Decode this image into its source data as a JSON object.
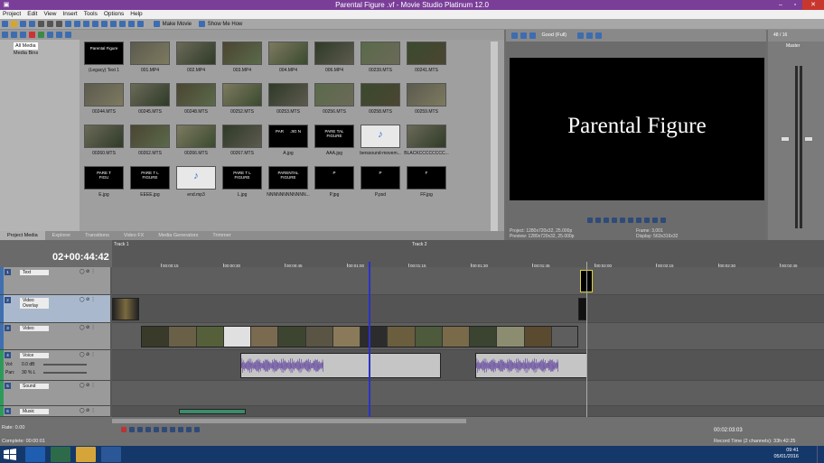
{
  "window": {
    "title": "Parental Figure .vf - Movie Studio Platinum 12.0"
  },
  "menu": [
    "Project",
    "Edit",
    "View",
    "Insert",
    "Tools",
    "Options",
    "Help"
  ],
  "toolbar": {
    "make_movie": "Make Movie",
    "show_me_how": "Show Me How"
  },
  "tree": {
    "items": [
      "All Media",
      "Media Bins"
    ]
  },
  "media": [
    {
      "label": "(Legacy) Text 1",
      "kind": "title",
      "text": "Parental Figure"
    },
    {
      "label": "001.MP4",
      "kind": "video"
    },
    {
      "label": "002.MP4",
      "kind": "video"
    },
    {
      "label": "003.MP4",
      "kind": "video"
    },
    {
      "label": "004.MP4",
      "kind": "video"
    },
    {
      "label": "006.MP4",
      "kind": "video"
    },
    {
      "label": "00239.MTS",
      "kind": "video"
    },
    {
      "label": "00241.MTS",
      "kind": "video"
    },
    {
      "label": "00244.MTS",
      "kind": "video"
    },
    {
      "label": "00245.MTS",
      "kind": "video"
    },
    {
      "label": "00248.MTS",
      "kind": "video"
    },
    {
      "label": "00252.MTS",
      "kind": "video"
    },
    {
      "label": "00253.MTS",
      "kind": "video"
    },
    {
      "label": "00256.MTS",
      "kind": "video"
    },
    {
      "label": "00258.MTS",
      "kind": "video"
    },
    {
      "label": "00259.MTS",
      "kind": "video"
    },
    {
      "label": "00260.MTS",
      "kind": "video"
    },
    {
      "label": "00262.MTS",
      "kind": "video"
    },
    {
      "label": "00266.MTS",
      "kind": "video"
    },
    {
      "label": "00267.MTS",
      "kind": "video"
    },
    {
      "label": "A.jpg",
      "kind": "title",
      "text": "PAR      JIG N"
    },
    {
      "label": "AAA.jpg",
      "kind": "title",
      "text": "PARE TAL\nFIGURE"
    },
    {
      "label": "berssound-movem...",
      "kind": "audio"
    },
    {
      "label": "BLACKCCCCCCCC...",
      "kind": "video"
    },
    {
      "label": "E.jpg",
      "kind": "title",
      "text": "PARE T\nFIGU"
    },
    {
      "label": "EEEE.jpg",
      "kind": "title",
      "text": "PARE T L\nFIGURE"
    },
    {
      "label": "end.mp3",
      "kind": "audio"
    },
    {
      "label": "L.jpg",
      "kind": "title",
      "text": "PARE T L\nFIGURE"
    },
    {
      "label": "NNNNNNNNNNNN...",
      "kind": "title",
      "text": "PARENTAL\nFIGURE"
    },
    {
      "label": "P.jpg",
      "kind": "title",
      "text": "P"
    },
    {
      "label": "P.psd",
      "kind": "title",
      "text": "P"
    },
    {
      "label": "FF.jpg",
      "kind": "title",
      "text": "F"
    }
  ],
  "tabs": [
    "Project Media",
    "Explorer",
    "Transitions",
    "Video FX",
    "Media Generators",
    "Trimmer"
  ],
  "preview": {
    "quality": "Good (Full)",
    "screen_text": "Parental Figure",
    "project": "Project:   1280x720x32, 25.000p",
    "preview_line": "Preview:   1280x720x32, 25.000p",
    "frame": "Frame:       3,001",
    "display": "Display:     563x316x32"
  },
  "master": {
    "label": "Master",
    "ratio": "48 / 16"
  },
  "timeline": {
    "timecode": "02+00:44:42",
    "markers": [
      "Track 1",
      "Track 2"
    ],
    "ticks": [
      "00:00:15",
      "00:00:30",
      "00:00:45",
      "00:01:00",
      "00:01:15",
      "00:01:30",
      "00:01:45",
      "00:02:00",
      "00:02:15",
      "00:02:30",
      "00:02:45"
    ]
  },
  "tracks": [
    {
      "name": "Text",
      "num": "1",
      "color": "#3f6fb0",
      "type": "video"
    },
    {
      "name": "Video Overlay",
      "num": "2",
      "color": "#3f6fb0",
      "type": "video"
    },
    {
      "name": "Video",
      "num": "3",
      "color": "#3f6fb0",
      "type": "video"
    },
    {
      "name": "Voice",
      "num": "4",
      "color": "#2e9a5a",
      "type": "audio",
      "vol": "0.0 dB",
      "pan": "30 % L"
    },
    {
      "name": "Sound",
      "num": "5",
      "color": "#2e9a5a",
      "type": "audio"
    },
    {
      "name": "Music",
      "num": "6",
      "color": "#2e9a5a",
      "type": "audio"
    }
  ],
  "track_labels": {
    "vol": "Vol:",
    "pan": "Pan:"
  },
  "rate": "Rate: 0.00",
  "transport": {
    "time": "00:02:03:03"
  },
  "status": {
    "left": "Complete: 00:00:01",
    "right": "Record Time (2 channels): 33h:42:25"
  },
  "clock": {
    "time": "09:41",
    "date": "05/01/2016"
  },
  "colors": {
    "accent": "#7a3e98",
    "taskbar": "#15386b",
    "cursor": "#2a32c8"
  }
}
